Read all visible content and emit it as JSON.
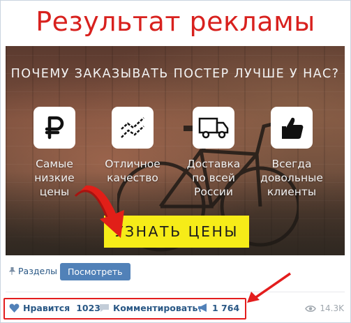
{
  "headline": "Результат рекламы",
  "ad": {
    "question": "ПОЧЕМУ ЗАКАЗЫВАТЬ ПОСТЕР ЛУЧШЕ У НАС?",
    "features": [
      {
        "icon": "ruble-icon",
        "label": "Самые\nнизкие цены"
      },
      {
        "icon": "trend-chart-icon",
        "label": "Отличное\nкачество"
      },
      {
        "icon": "delivery-truck-icon",
        "label": "Доставка\nпо всей\nРоссии"
      },
      {
        "icon": "thumbs-up-icon",
        "label": "Всегда\nдовольные\nклиенты"
      }
    ],
    "cta": "УЗНАТЬ ЦЕНЫ"
  },
  "actions": {
    "sections": "Разделы",
    "view_button": "Посмотреть",
    "like_label": "Нравится",
    "like_count": "1023",
    "comment_label": "Комментировать",
    "share_count": "1 764",
    "views": "14.3K"
  },
  "colors": {
    "headline": "#d8211e",
    "link": "#2a5885",
    "button": "#5181b8",
    "cta": "#f6ec18",
    "highlight_box": "#e31d1d"
  }
}
